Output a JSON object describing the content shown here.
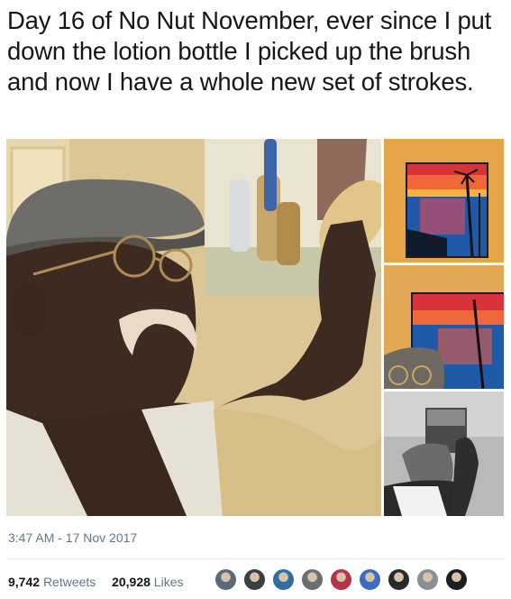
{
  "tweet": {
    "text": "Day 16 of No Nut November, ever since I put down the lotion bottle I picked up the brush and now I have a whole new set of strokes.",
    "timestamp": "3:47 AM - 17 Nov 2017"
  },
  "stats": {
    "retweets_count": "9,742",
    "retweets_label": "Retweets",
    "likes_count": "20,928",
    "likes_label": "Likes"
  },
  "media": {
    "photos": [
      {
        "name": "selfie-with-painting"
      },
      {
        "name": "sunset-palm-painting"
      },
      {
        "name": "sunset-palm-painting-closeup"
      },
      {
        "name": "holding-painting-bw"
      }
    ]
  },
  "likers": {
    "avatar_colors": [
      "#5a6a7a",
      "#3a3f44",
      "#2f6fa0",
      "#6a6f74",
      "#b8324a",
      "#3b6cc4",
      "#2a2a2a",
      "#8a8f95",
      "#1e1e1e"
    ]
  }
}
